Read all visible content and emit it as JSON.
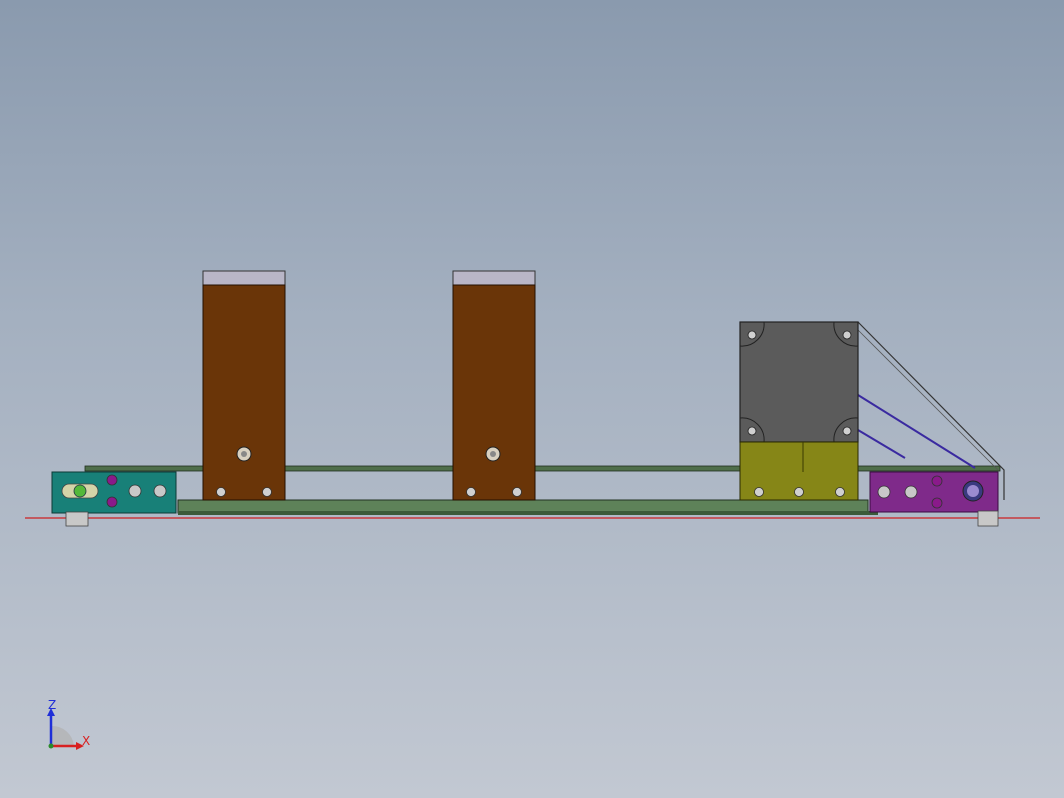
{
  "viewport": {
    "background": [
      "#8a9aae",
      "#c2c8d2"
    ],
    "model": {
      "colors": {
        "column": "#6a3508",
        "column_cap": "#b9b6c7",
        "rail": "#4f6e4a",
        "base_plate": "#5e8259",
        "left_block": "#188078",
        "right_block": "#7f2a8a",
        "motor": "#5b5b5b",
        "motor_base": "#868617",
        "hole": "#c8c8c8",
        "feature": "#8a1a8a",
        "bracket_line": "#3a2aa0",
        "origin_line": "#cc2222"
      }
    },
    "triad": {
      "z_label": "Z",
      "x_label": "X",
      "z_color": "#1f2fd8",
      "x_color": "#d82020"
    }
  }
}
